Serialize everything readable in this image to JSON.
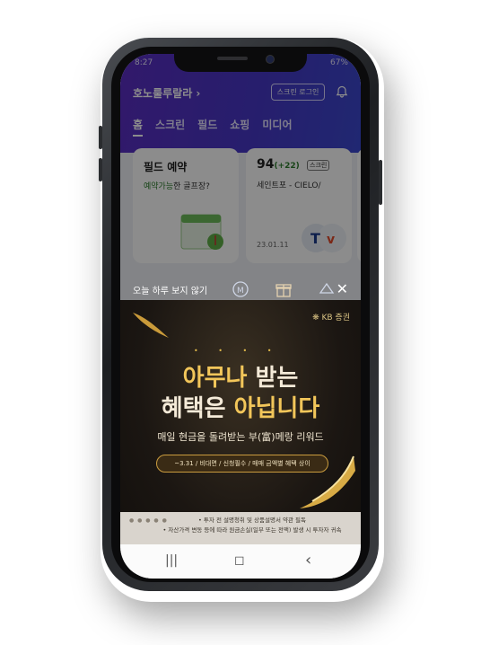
{
  "status_bar": {
    "time": "8:27",
    "battery": "67%"
  },
  "header": {
    "user_name": "호노룰루랄라 ›",
    "login_button": "스크린 로그인"
  },
  "tabs": [
    {
      "label": "홈",
      "active": true
    },
    {
      "label": "스크린",
      "active": false
    },
    {
      "label": "필드",
      "active": false
    },
    {
      "label": "쇼핑",
      "active": false
    },
    {
      "label": "미디어",
      "active": false
    }
  ],
  "cards": {
    "field_booking": {
      "title": "필드 예약",
      "highlight": "예약가능",
      "rest": "한 골프장?"
    },
    "score": {
      "score": "94",
      "diff": "(+22)",
      "badge": "스크린",
      "course": "세인트포 - CIELO/",
      "date": "23.01.11"
    }
  },
  "popup": {
    "dont_show_today": "오늘 하루 보지 않기",
    "close": "✕",
    "brand": "KB 증권",
    "headline1_gold": "아무나",
    "headline1_rest": " 받는",
    "headline2_a": "혜택은 ",
    "headline2_gold": "아닙니다",
    "subtitle": "매일 현금을 돌려받는 부(富)메랑 리워드",
    "period": "~3.31 / 비대면 / 신청필수 / 매매 금액별 혜택 상이",
    "disclaimer1": "• 투자 전 설명청취 및 상품설명서 약관 필독",
    "disclaimer2": "• 자산가격 변동 등에 따라 원금손실(일부 또는 전액) 발생 시 투자자 귀속"
  },
  "nav": {
    "recent": "|||",
    "home": "◻",
    "back": "‹"
  },
  "colors": {
    "header_start": "#5b2ec4",
    "header_end": "#3b48cf",
    "gold": "#f2c65a"
  }
}
